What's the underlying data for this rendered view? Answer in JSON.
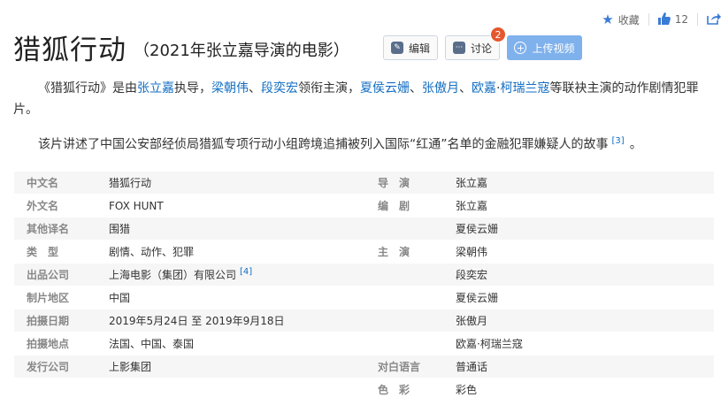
{
  "top_actions": {
    "favorite_label": "收藏",
    "like_count": "12"
  },
  "title": {
    "main": "猎狐行动",
    "sub": "（2021年张立嘉导演的电影）"
  },
  "toolbar": {
    "edit_label": "编辑",
    "discuss_label": "讨论",
    "discuss_badge": "2",
    "upload_label": "上传视频"
  },
  "summary": {
    "p1_t1": "《猎狐行动》是由",
    "p1_link1": "张立嘉",
    "p1_t2": "执导，",
    "p1_link2": "梁朝伟",
    "p1_sep1": "、",
    "p1_link3": "段奕宏",
    "p1_t3": "领衔主演，",
    "p1_link4": "夏侯云姗",
    "p1_sep2": "、",
    "p1_link5": "张傲月",
    "p1_sep3": "、",
    "p1_link6": "欧嘉",
    "p1_sep4": "·",
    "p1_link7": "柯瑞兰寇",
    "p1_t4": "等联袂主演的动作剧情犯罪片。",
    "p2_text": "该片讲述了中国公安部经侦局猎狐专项行动小组跨境追捕被列入国际“红通”名单的金融犯罪嫌疑人的故事",
    "p2_ref": "[3]",
    "p2_end": "。"
  },
  "info": {
    "rows": [
      {
        "label": "中文名",
        "value": "猎狐行动",
        "label2": "导　演",
        "value2": "张立嘉"
      },
      {
        "label": "外文名",
        "value": "FOX HUNT",
        "label2": "编　剧",
        "value2": "张立嘉"
      },
      {
        "label": "其他译名",
        "value": "围猎",
        "label2": "",
        "value2": "夏侯云姗"
      },
      {
        "label": "类　型",
        "value": "剧情、动作、犯罪",
        "label2": "主　演",
        "value2": "梁朝伟"
      },
      {
        "label": "出品公司",
        "value": "上海电影（集团）有限公司",
        "value_ref": "[4]",
        "label2": "",
        "value2": "段奕宏"
      },
      {
        "label": "制片地区",
        "value": "中国",
        "label2": "",
        "value2": "夏侯云姗"
      },
      {
        "label": "拍摄日期",
        "value": "2019年5月24日 至 2019年9月18日",
        "label2": "",
        "value2": "张傲月"
      },
      {
        "label": "拍摄地点",
        "value": "法国、中国、泰国",
        "label2": "",
        "value2": "欧嘉·柯瑞兰寇"
      },
      {
        "label": "发行公司",
        "value": "上影集团",
        "label2": "对白语言",
        "value2": "普通话"
      },
      {
        "label": "",
        "value": "",
        "label2": "色　彩",
        "value2": "彩色"
      }
    ]
  },
  "colors": {
    "link": "#136ec2",
    "upload_button": "#7fb1ec",
    "badge": "#e4572e"
  }
}
